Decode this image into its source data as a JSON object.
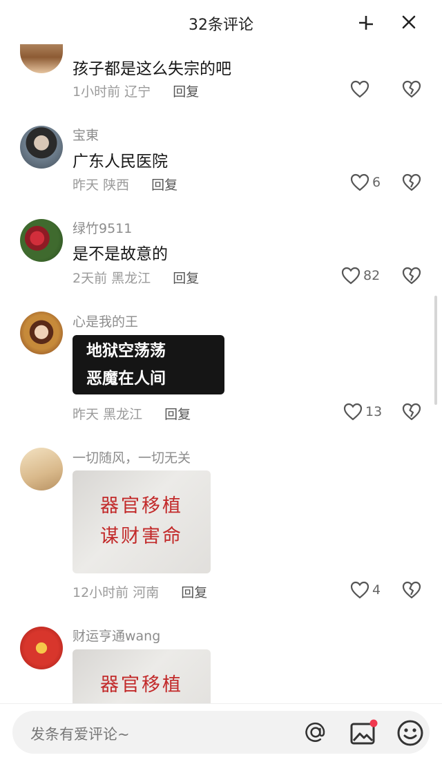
{
  "header": {
    "title": "32条评论"
  },
  "comments": [
    {
      "username": "",
      "text": "孩子都是这么失宗的吧",
      "time": "1小时前",
      "location": "辽宁",
      "reply": "回复",
      "likes": ""
    },
    {
      "username": "宝東",
      "text": "广东人民医院",
      "time": "昨天",
      "location": "陕西",
      "reply": "回复",
      "likes": "6"
    },
    {
      "username": "绿竹9511",
      "text": "是不是故意的",
      "time": "2天前",
      "location": "黑龙江",
      "reply": "回复",
      "likes": "82"
    },
    {
      "username": "心是我的王",
      "image_lines": [
        "地狱空荡荡",
        "恶魔在人间"
      ],
      "time": "昨天",
      "location": "黑龙江",
      "reply": "回复",
      "likes": "13"
    },
    {
      "username": "一切随风，一切无关",
      "image_lines": [
        "器官移植",
        "谋财害命"
      ],
      "time": "12小时前",
      "location": "河南",
      "reply": "回复",
      "likes": "4"
    },
    {
      "username": "财运亨通wang",
      "image_lines": [
        "器官移植"
      ]
    }
  ],
  "input": {
    "placeholder": "发条有爱评论~"
  },
  "colors": {
    "accent_dot": "#f0394f",
    "text": "#161616",
    "meta": "#9a9a9a"
  },
  "icons": [
    "collapse-icon",
    "close-icon",
    "heart-icon",
    "dislike-heart-icon",
    "at-icon",
    "image-icon",
    "emoji-icon"
  ]
}
